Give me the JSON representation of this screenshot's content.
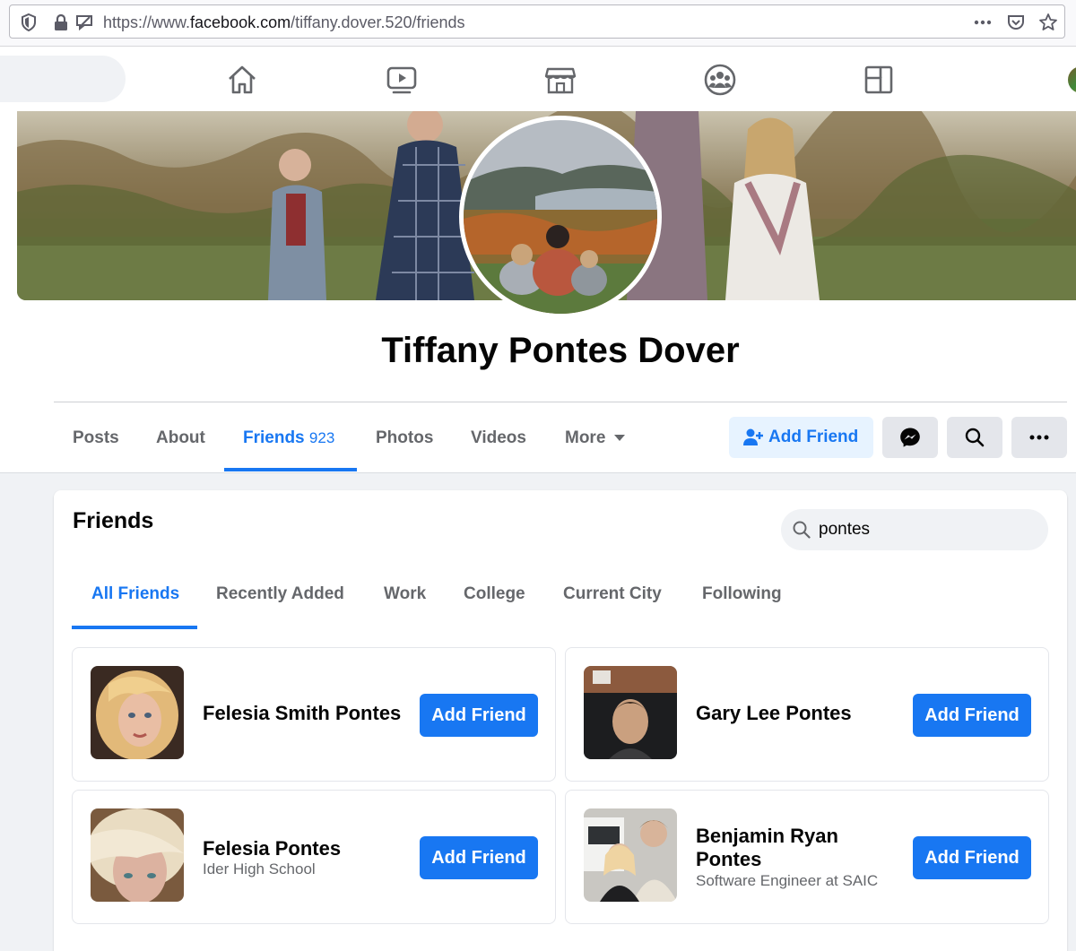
{
  "browser": {
    "url_prefix": "https://www.",
    "url_domain": "facebook.com",
    "url_path": "/tiffany.dover.520/friends"
  },
  "fb_nav": {
    "icons": [
      "home-icon",
      "watch-icon",
      "marketplace-icon",
      "groups-icon",
      "gaming-icon"
    ]
  },
  "profile": {
    "name": "Tiffany Pontes Dover"
  },
  "profile_tabs": [
    {
      "label": "Posts"
    },
    {
      "label": "About"
    },
    {
      "label": "Friends",
      "count": "923"
    },
    {
      "label": "Photos"
    },
    {
      "label": "Videos"
    },
    {
      "label": "More"
    }
  ],
  "profile_actions": {
    "add_friend_label": "Add Friend"
  },
  "friends": {
    "title": "Friends",
    "search_value": "pontes",
    "subtabs": [
      "All Friends",
      "Recently Added",
      "Work",
      "College",
      "Current City",
      "Following"
    ],
    "items": [
      {
        "name": "Felesia Smith Pontes",
        "subtitle": "",
        "button": "Add Friend"
      },
      {
        "name": "Gary Lee Pontes",
        "subtitle": "",
        "button": "Add Friend"
      },
      {
        "name": "Felesia Pontes",
        "subtitle": "Ider High School",
        "button": "Add Friend"
      },
      {
        "name_line1": "Benjamin Ryan",
        "name_line2": "Pontes",
        "subtitle": "Software Engineer at SAIC",
        "button": "Add Friend"
      }
    ]
  },
  "colors": {
    "accent": "#1877f2",
    "accent_light": "#e7f3ff",
    "background": "#f0f2f5",
    "muted_text": "#65676b"
  }
}
